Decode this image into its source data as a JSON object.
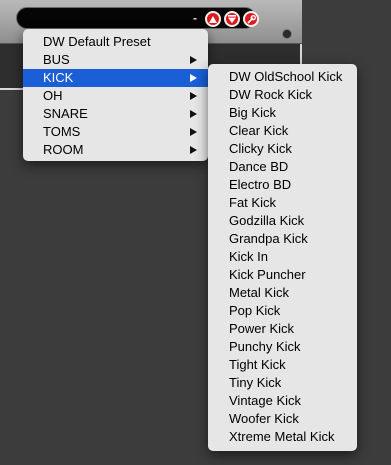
{
  "plugin": {
    "preset_value": "-"
  },
  "main_menu": {
    "items": [
      {
        "label": "DW Default Preset",
        "submenu": false
      },
      {
        "label": "BUS",
        "submenu": true
      },
      {
        "label": "KICK",
        "submenu": true
      },
      {
        "label": "OH",
        "submenu": true
      },
      {
        "label": "SNARE",
        "submenu": true
      },
      {
        "label": "TOMS",
        "submenu": true
      },
      {
        "label": "ROOM",
        "submenu": true
      }
    ],
    "highlighted": "KICK"
  },
  "kick_submenu": {
    "items": [
      "DW OldSchool Kick",
      "DW Rock Kick",
      "Big Kick",
      "Clear Kick",
      "Clicky Kick",
      "Dance BD",
      "Electro BD",
      "Fat Kick",
      "Godzilla Kick",
      "Grandpa Kick",
      "Kick In",
      "Kick Puncher",
      "Metal Kick",
      "Pop Kick",
      "Power Kick",
      "Punchy Kick",
      "Tight Kick",
      "Tiny Kick",
      "Vintage Kick",
      "Woofer Kick",
      "Xtreme Metal Kick"
    ]
  },
  "colors": {
    "highlight": "#1a5fd6",
    "button_red": "#e0181c",
    "menu_bg": "#e6e6e6"
  },
  "icons": [
    "previous-preset-icon",
    "next-preset-icon",
    "wrench-icon",
    "submenu-arrow-icon"
  ]
}
